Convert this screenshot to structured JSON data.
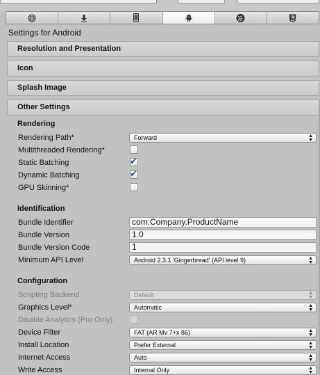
{
  "window": {
    "settings_title": "Settings for Android"
  },
  "platform_tabs": [
    {
      "icon": "globe-icon",
      "active": false
    },
    {
      "icon": "download-icon",
      "active": false
    },
    {
      "icon": "phone-icon",
      "active": false
    },
    {
      "icon": "android-icon",
      "active": true
    },
    {
      "icon": "blackberry-icon",
      "active": false
    },
    {
      "icon": "html5-icon",
      "active": false
    }
  ],
  "foldouts": {
    "resolution": "Resolution and Presentation",
    "icon": "Icon",
    "splash": "Splash Image",
    "other": "Other Settings"
  },
  "rendering": {
    "heading": "Rendering",
    "rendering_path_label": "Rendering Path*",
    "rendering_path_value": "Forward",
    "multithreaded_label": "Multithreaded Rendering*",
    "multithreaded_checked": false,
    "static_batching_label": "Static Batching",
    "static_batching_checked": true,
    "dynamic_batching_label": "Dynamic Batching",
    "dynamic_batching_checked": true,
    "gpu_skinning_label": "GPU Skinning*",
    "gpu_skinning_checked": false
  },
  "identification": {
    "heading": "Identification",
    "bundle_identifier_label": "Bundle Identifier",
    "bundle_identifier_value": "com.Company.ProductName",
    "bundle_version_label": "Bundle Version",
    "bundle_version_value": "1.0",
    "bundle_version_code_label": "Bundle Version Code",
    "bundle_version_code_value": "1",
    "min_api_label": "Minimum API Level",
    "min_api_value": "Android 2.3.1 'Gingerbread' (API level 9)"
  },
  "configuration": {
    "heading": "Configuration",
    "scripting_backend_label": "Scripting Backend",
    "scripting_backend_value": "Default",
    "graphics_level_label": "Graphics Level*",
    "graphics_level_value": "Automatic",
    "disable_analytics_label": "Disable Analytics (Pro Only)",
    "disable_analytics_checked": false,
    "device_filter_label": "Device Filter",
    "device_filter_value": "FAT (AR Mv 7+x 86)",
    "install_location_label": "Install Location",
    "install_location_value": "Prefer External",
    "internet_access_label": "Internet Access",
    "internet_access_value": "Auto",
    "write_access_label": "Write Access",
    "write_access_value": "Internal Only"
  },
  "colors": {
    "background": "#c2c2c2",
    "checkmark": "#2a4f9a"
  }
}
